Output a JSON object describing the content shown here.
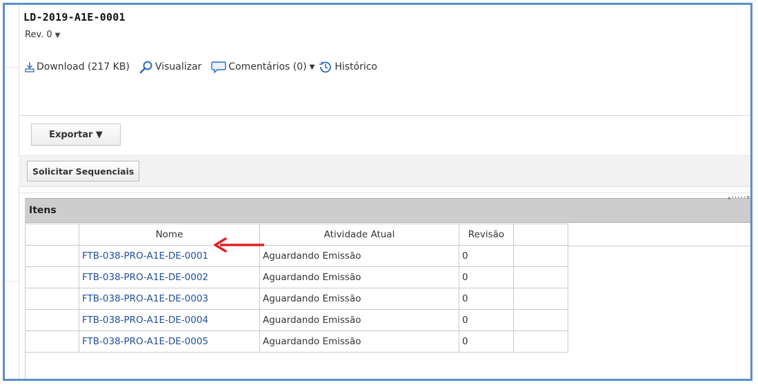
{
  "document": {
    "title": "LD-2019-A1E-0001",
    "revision": "Rev. 0"
  },
  "toolbar": {
    "download": "Download (217 KB)",
    "view": "Visualizar",
    "comments": "Comentários (0)",
    "history": "Histórico"
  },
  "actions": {
    "export_label": "Exportar ▼",
    "request_sequentials": "Solicitar Sequenciais"
  },
  "items_panel": {
    "title": "Itens",
    "columns": [
      "Nome",
      "Atividade Atual",
      "Revisão"
    ],
    "rows": [
      {
        "name": "FTB-038-PRO-A1E-DE-0001",
        "activity": "Aguardando Emissão",
        "revision": "0"
      },
      {
        "name": "FTB-038-PRO-A1E-DE-0002",
        "activity": "Aguardando Emissão",
        "revision": "0"
      },
      {
        "name": "FTB-038-PRO-A1E-DE-0003",
        "activity": "Aguardando Emissão",
        "revision": "0"
      },
      {
        "name": "FTB-038-PRO-A1E-DE-0004",
        "activity": "Aguardando Emissão",
        "revision": "0"
      },
      {
        "name": "FTB-038-PRO-A1E-DE-0005",
        "activity": "Aguardando Emissão",
        "revision": "0"
      }
    ]
  },
  "colors": {
    "frame_border": "#5b8fc7",
    "link": "#1f4e9c",
    "icon_blue": "#2b6bbf",
    "annotation_arrow": "#e02020",
    "panel_header_bg": "#cdcdcd"
  },
  "icons": [
    "download-icon",
    "magnifier-icon",
    "comment-bubble-icon",
    "history-icon",
    "caret-down-icon",
    "red-annotation-arrow"
  ]
}
